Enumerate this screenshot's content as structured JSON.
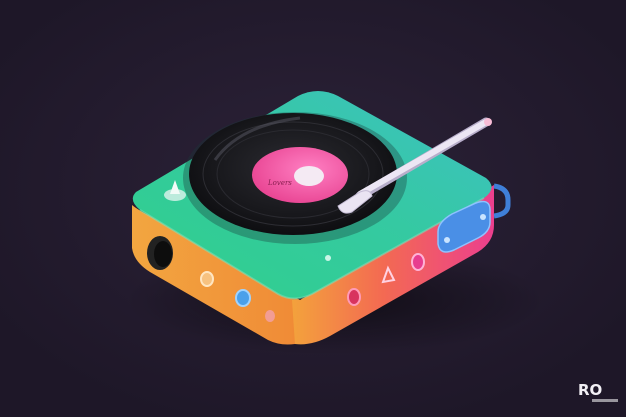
{
  "scene": {
    "subject": "turntable-illustration",
    "colors": {
      "background": "#221a2e",
      "top_teal": "#3cc6b4",
      "top_green": "#2fcf7e",
      "body_orange": "#f2a13a",
      "body_pink": "#f04a8a",
      "record": "#1b1b1f",
      "label": "#f259a8",
      "tonearm": "#e9e3f2",
      "blue_knob": "#4a92e8"
    },
    "record_label_text": "Lovers"
  },
  "watermark": {
    "text": "RO",
    "icon": "book-icon"
  }
}
